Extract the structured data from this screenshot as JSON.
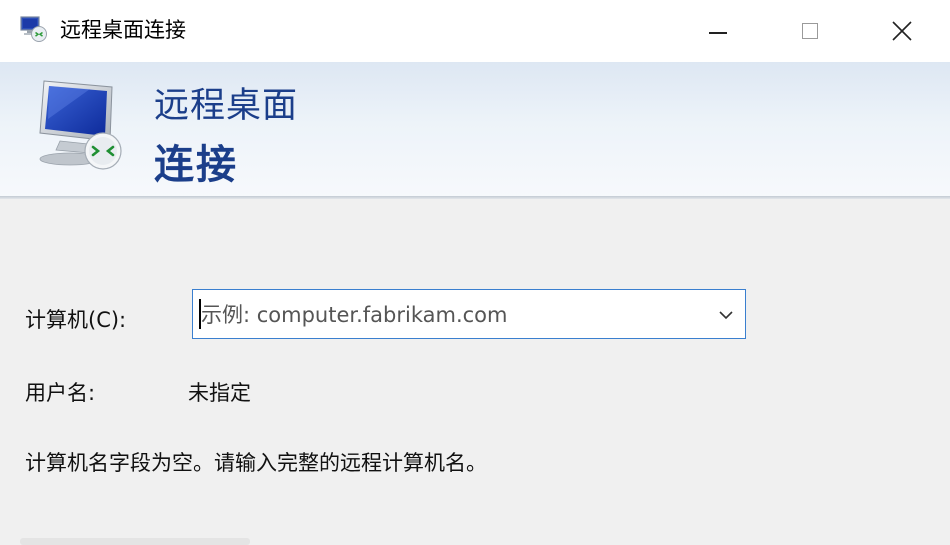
{
  "window": {
    "title": "远程桌面连接",
    "controls": {
      "minimize": "minimize-icon",
      "maximize": "maximize-icon",
      "close": "close-icon"
    }
  },
  "banner": {
    "icon": "remote-desktop-monitor-icon",
    "line1": "远程桌面",
    "line2": "连接"
  },
  "form": {
    "computer_label": "计算机(C):",
    "computer_placeholder": "示例: computer.fabrikam.com",
    "computer_value": "",
    "username_label": "用户名:",
    "username_value": "未指定",
    "status_message": "计算机名字段为空。请输入完整的远程计算机名。"
  },
  "colors": {
    "banner_text": "#1b3e8a",
    "input_border": "#3a7fcf",
    "background": "#f0f0f0"
  }
}
